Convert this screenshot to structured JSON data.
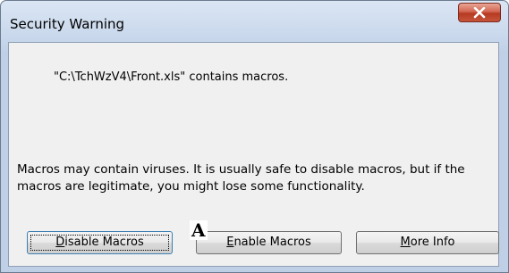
{
  "window": {
    "title": "Security Warning"
  },
  "close_button": {
    "icon": "close-x-icon"
  },
  "message": {
    "file_line": "\"C:\\TchWzV4\\Front.xls\" contains macros.",
    "warning_line": "Macros may contain viruses. It is usually safe to disable macros, but if the macros are legitimate, you might lose some functionality."
  },
  "buttons": {
    "disable": {
      "mnemonic": "D",
      "rest": "isable Macros"
    },
    "enable": {
      "mnemonic": "E",
      "rest": "nable Macros"
    },
    "more_info": {
      "mnemonic": "M",
      "rest": "ore Info"
    }
  },
  "annotation": {
    "label": "A"
  },
  "colors": {
    "title_gradient_top": "#dbe6f4",
    "content_bg": "#f0f0f0",
    "close_red": "#c5553a",
    "focus_border": "#3c7fb1"
  }
}
